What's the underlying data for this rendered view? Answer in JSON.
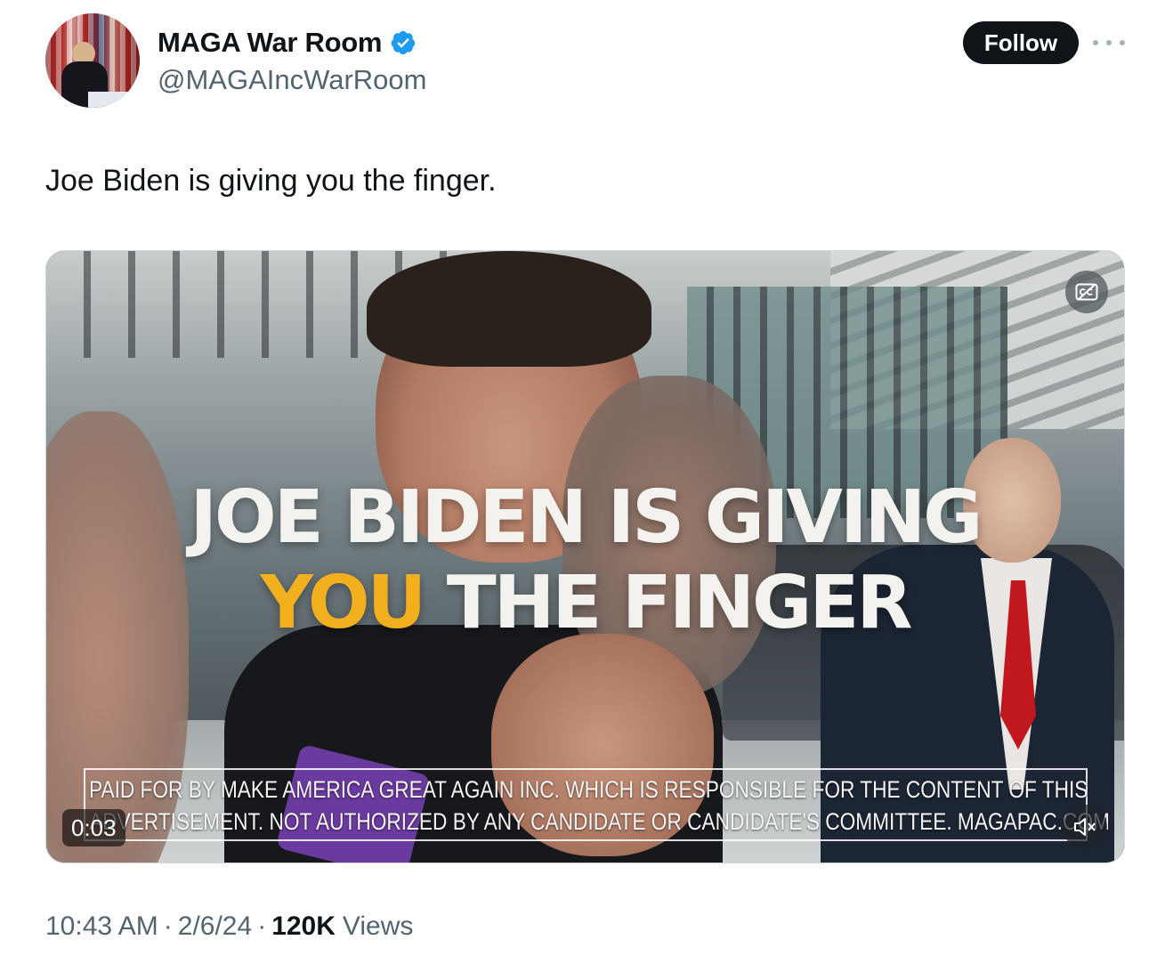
{
  "author": {
    "display_name": "MAGA War Room",
    "handle": "@MAGAIncWarRoom",
    "verified": true,
    "verified_color": "#1d9bf0"
  },
  "actions": {
    "follow_label": "Follow",
    "more_icon": "more-horizontal-icon"
  },
  "tweet": {
    "text": "Joe Biden is giving you the finger."
  },
  "video": {
    "headline_line1": "JOE BIDEN IS GIVING",
    "headline_highlight": "YOU",
    "headline_rest": " THE FINGER",
    "highlight_color": "#f2b01e",
    "disclaimer_line1": "PAID FOR BY MAKE AMERICA GREAT AGAIN INC. WHICH IS RESPONSIBLE FOR THE CONTENT OF THIS",
    "disclaimer_line2": "ADVERTISEMENT. NOT AUTHORIZED BY ANY CANDIDATE OR CANDIDATE'S COMMITTEE. MAGAPAC.COM",
    "duration_badge": "0:03",
    "captions_icon": "captions-off-icon",
    "mute_icon": "speaker-muted-icon"
  },
  "meta": {
    "time": "10:43 AM",
    "separator": "·",
    "date": "2/6/24",
    "views_count": "120K",
    "views_label": "Views"
  }
}
